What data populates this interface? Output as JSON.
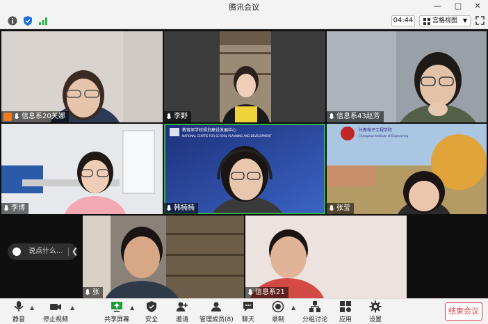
{
  "window": {
    "title": "腾讯会议",
    "controls": [
      "minimize-icon",
      "maximize-icon",
      "close-icon"
    ]
  },
  "toolbar": {
    "timer": "04:44",
    "view_label": "宫格视图",
    "icons": [
      "info-icon",
      "shield-icon",
      "signal-icon",
      "fullscreen-icon"
    ]
  },
  "participants": [
    {
      "name": "信息系20关娜",
      "host": true,
      "bg": "#d8d3cf"
    },
    {
      "name": "李野",
      "host": false,
      "bg": "#3b3b3b"
    },
    {
      "name": "信息系43赵芳",
      "host": false,
      "bg": "#8e949c"
    },
    {
      "name": "李博",
      "host": false,
      "bg": "#dcdfe3"
    },
    {
      "name": "韩楠楠",
      "host": false,
      "bg": "#2a3c8a"
    },
    {
      "name": "张莹",
      "host": false,
      "bg": "#c8a36a"
    },
    {
      "name": "张",
      "host": false,
      "bg": "#7e786e"
    },
    {
      "name": "信息系21",
      "host": false,
      "bg": "#e7d9d6"
    }
  ],
  "backdrop_text": {
    "ministry_banner": "教育部学校规划建设发展中心",
    "ministry_sub": "NATIONAL CENTRE FOR SCHOOL PLANNING AND DEVELOPMENT",
    "college_name": "长春电子工程学院",
    "college_sub": "Changchun Institute of Engineering"
  },
  "chat": {
    "placeholder": "说点什么..."
  },
  "bottom_toolbar": {
    "mute": "静音",
    "stop_video": "停止视频",
    "share_screen": "共享屏幕",
    "security": "安全",
    "invite": "邀请",
    "manage_members": "管理成员(8)",
    "chat": "聊天",
    "record": "录制",
    "breakout": "分组讨论",
    "apps": "应用",
    "settings": "设置",
    "end_meeting": "结束会议"
  },
  "colors": {
    "accent_green": "#2fb54a",
    "end_red": "#e03a3a",
    "host_orange": "#f07c1b"
  }
}
